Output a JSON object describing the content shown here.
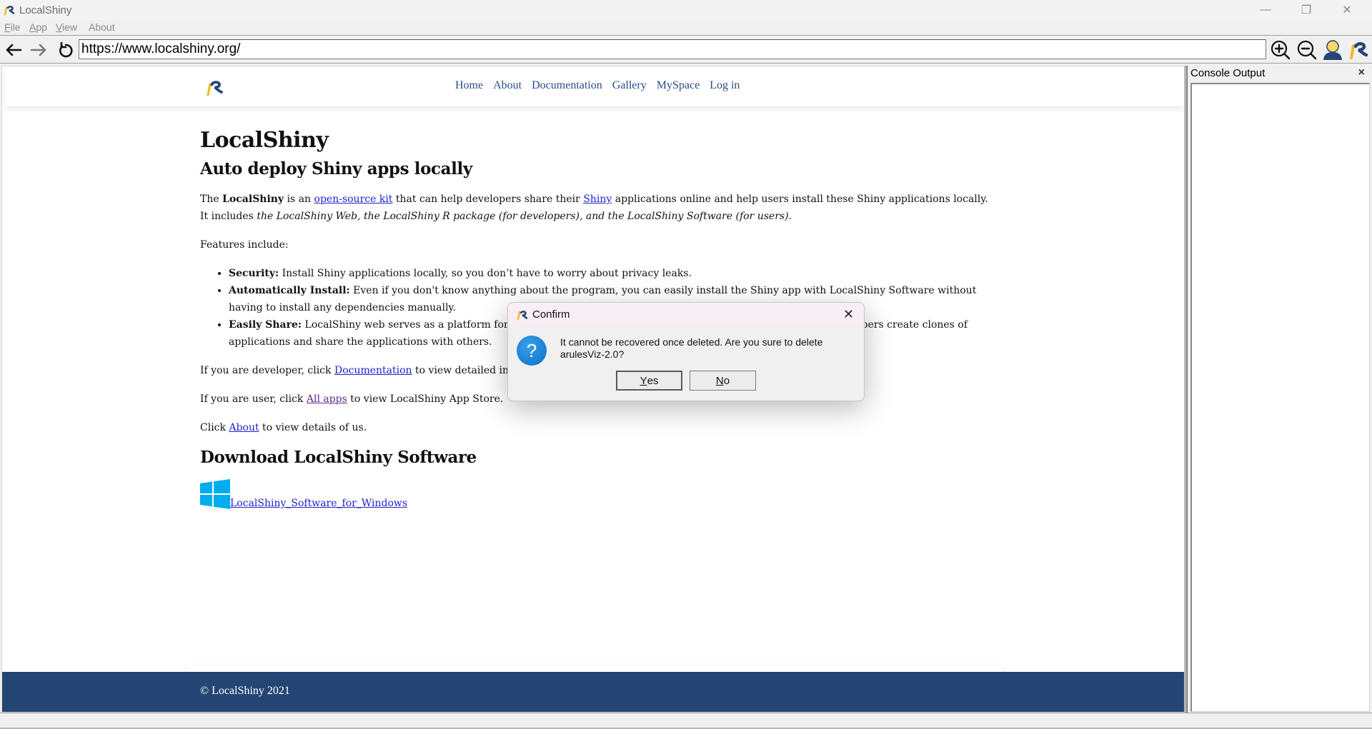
{
  "window": {
    "title": "LocalShiny",
    "controls": {
      "minimize": "—",
      "maximize": "❐",
      "close": "✕"
    }
  },
  "menu": [
    {
      "label": "File",
      "accel": "F",
      "rest": "ile"
    },
    {
      "label": "App",
      "accel": "A",
      "rest": "pp"
    },
    {
      "label": "View",
      "accel": "V",
      "rest": "iew"
    },
    {
      "label": "About",
      "accel": "",
      "rest": "About"
    }
  ],
  "toolbar": {
    "back_icon": "arrow-left-icon",
    "forward_icon": "arrow-right-icon",
    "reload_icon": "reload-icon",
    "url": "https://www.localshiny.org/",
    "zoom_in_icon": "zoom-in-icon",
    "zoom_out_icon": "zoom-out-icon",
    "user_icon": "user-icon",
    "logo_icon": "localshiny-logo-icon"
  },
  "site": {
    "nav": [
      "Home",
      "About",
      "Documentation",
      "Gallery",
      "MySpace",
      "Log in"
    ],
    "title": "LocalShiny",
    "subtitle": "Auto deploy Shiny apps locally",
    "intro": {
      "t1": "The ",
      "bold": "LocalShiny",
      "t2": " is an ",
      "link1": "open-source kit",
      "t3": " that can help developers share their ",
      "link2": "Shiny",
      "t4": " applications online and help users install these Shiny applications locally.",
      "t5": "It includes ",
      "italic": "the LocalShiny Web, the LocalShiny R package (for developers), and the LocalShiny Software (for users)",
      "t6": "."
    },
    "features_label": "Features include:",
    "features": [
      {
        "title": "Security:",
        "text": " Install Shiny applications locally, so you don’t have to worry about privacy leaks."
      },
      {
        "title": "Automatically Install:",
        "text": " Even if you don't know anything about the program, you can easily install the Shiny app with LocalShiny Software without having to install any dependencies manually."
      },
      {
        "title": "Easily Share:",
        "text": " LocalShiny web serves as a platform for developers to share applications. With LocalShiny R package, developers create clones of applications and share the applications with others."
      }
    ],
    "dev_para": {
      "t1": "If you are developer, click ",
      "link": "Documentation",
      "t2": " to view detailed instructions."
    },
    "user_para": {
      "t1": "If you are user, click ",
      "link": "All apps",
      "t2": " to view LocalShiny App Store."
    },
    "about_para": {
      "t1": "Click ",
      "link": "About",
      "t2": " to view details of us."
    },
    "download_heading": "Download LocalShiny Software",
    "download_link": "LocalShiny_Software_for_Windows",
    "footer": "© LocalShiny 2021"
  },
  "console": {
    "title": "Console Output",
    "close": "×"
  },
  "dialog": {
    "title": "Confirm",
    "message": "It cannot be recovered once deleted. Are you sure to delete arulesViz-2.0?",
    "yes": {
      "accel": "Y",
      "rest": "es"
    },
    "no": {
      "accel": "N",
      "rest": "o"
    },
    "icon": "question-icon",
    "close": "✕"
  },
  "colors": {
    "footer_bg": "#254674",
    "brand_blue": "#254674",
    "brand_yellow": "#f5b82e",
    "link": "#2020cc",
    "windows_icon": "#00adef"
  }
}
